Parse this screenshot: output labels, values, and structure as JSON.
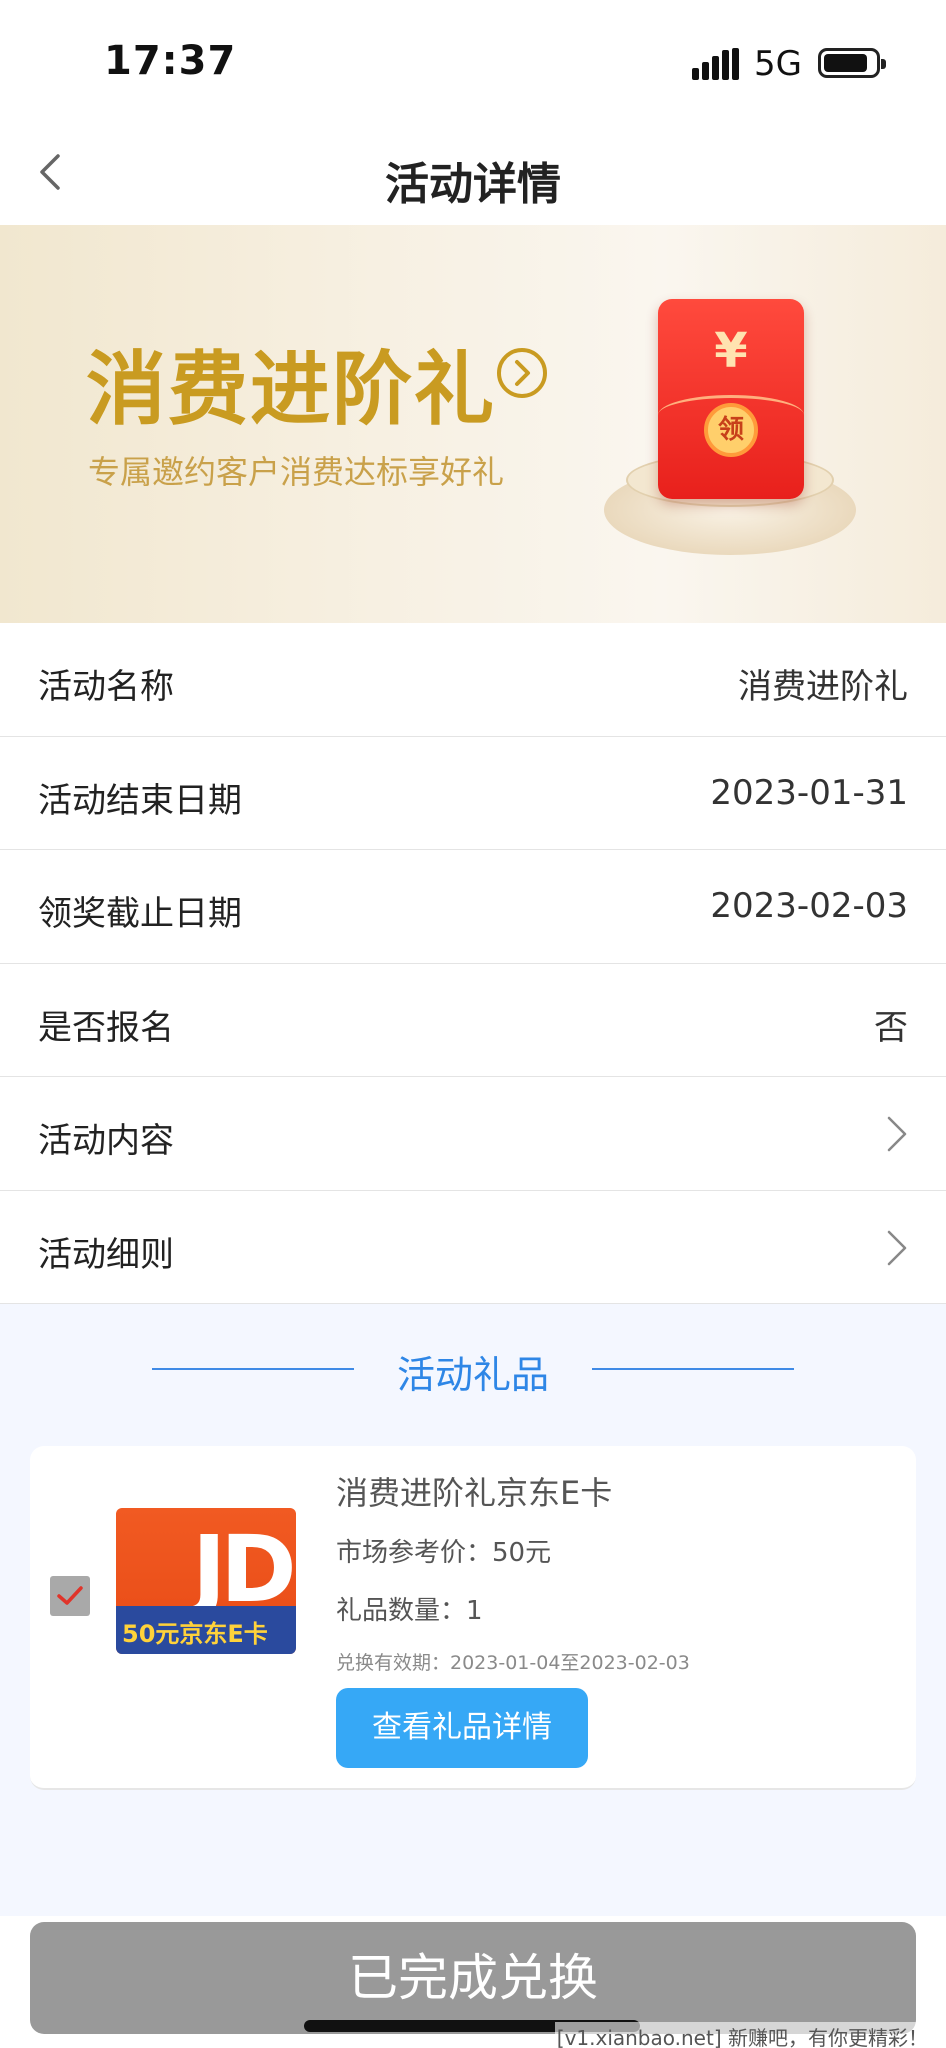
{
  "status_bar": {
    "time": "17:37",
    "network": "5G"
  },
  "nav": {
    "title": "活动详情",
    "back_icon": "chevron-left-icon"
  },
  "banner": {
    "title": "消费进阶礼",
    "subtitle": "专属邀约客户消费达标享好礼",
    "envelope_symbol": "¥",
    "envelope_seal": "领",
    "title_color": "#c99b21",
    "envelope_color": "#e8201c"
  },
  "info_rows": [
    {
      "label": "活动名称",
      "value": "消费进阶礼"
    },
    {
      "label": "活动结束日期",
      "value": "2023-01-31"
    },
    {
      "label": "领奖截止日期",
      "value": "2023-02-03"
    },
    {
      "label": "是否报名",
      "value": "否"
    },
    {
      "label": "活动内容",
      "icon": "chevron-right-icon"
    },
    {
      "label": "活动细则",
      "icon": "chevron-right-icon"
    }
  ],
  "gifts": {
    "heading": "活动礼品",
    "accent_color": "#2e86e6",
    "item": {
      "checked": true,
      "image_text": "50元京东E卡",
      "image_logo": "JD",
      "name": "消费进阶礼京东E卡",
      "price": "市场参考价：50元",
      "quantity": "礼品数量：1",
      "validity": "兑换有效期：2023-01-04至2023-02-03",
      "detail_button": "查看礼品详情",
      "button_color": "#36a8f6"
    }
  },
  "footer": {
    "complete_button": "已完成兑换",
    "button_color": "#999999",
    "watermark": "[v1.xianbao.net] 新赚吧，有你更精彩！"
  }
}
